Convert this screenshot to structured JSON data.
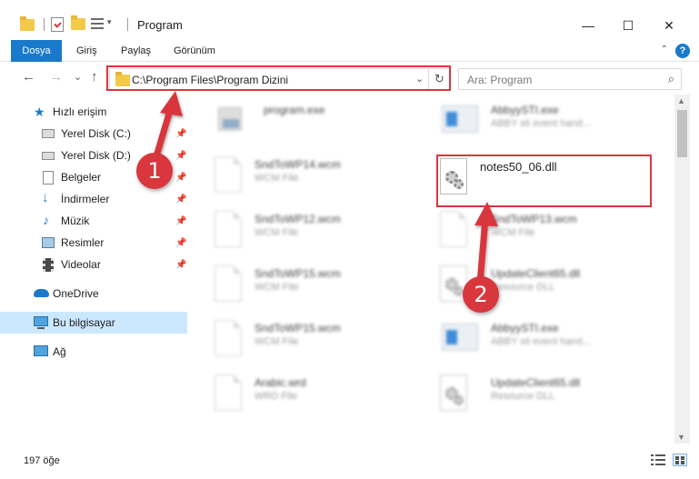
{
  "window": {
    "title": "Program",
    "minimize": "—",
    "maximize": "☐",
    "close": "✕"
  },
  "ribbon": {
    "tabs": [
      {
        "label": "Dosya"
      },
      {
        "label": "Giriş"
      },
      {
        "label": "Paylaş"
      },
      {
        "label": "Görünüm"
      }
    ],
    "help": "?",
    "collapse": "⌃"
  },
  "nav": {
    "back": "←",
    "forward": "→",
    "recent": "⌄",
    "up": "↑",
    "address": "C:\\Program Files\\Program Dizini",
    "address_dropdown": "⌄",
    "refresh": "↻",
    "search_placeholder": "Ara: Program",
    "search_icon": "⌕"
  },
  "sidebar": {
    "items": [
      {
        "label": "Hızlı erişim",
        "icon": "star-icon",
        "pinned": false
      },
      {
        "label": "Yerel Disk (C:)",
        "icon": "drive-icon",
        "pinned": true
      },
      {
        "label": "Yerel Disk (D:)",
        "icon": "drive-icon",
        "pinned": true
      },
      {
        "label": "Belgeler",
        "icon": "documents-icon",
        "pinned": true
      },
      {
        "label": "İndirmeler",
        "icon": "download-icon",
        "pinned": true
      },
      {
        "label": "Müzik",
        "icon": "music-icon",
        "pinned": true
      },
      {
        "label": "Resimler",
        "icon": "pictures-icon",
        "pinned": true
      },
      {
        "label": "Videolar",
        "icon": "videos-icon",
        "pinned": true
      },
      {
        "label": "OneDrive",
        "icon": "cloud-icon",
        "pinned": false
      },
      {
        "label": "Bu bilgisayar",
        "icon": "computer-icon",
        "pinned": false,
        "selected": true
      },
      {
        "label": "Ağ",
        "icon": "network-icon",
        "pinned": false
      }
    ],
    "pin_glyph": "📌"
  },
  "files": {
    "left": [
      {
        "name": "program.exe",
        "sub": "",
        "icon": "exe-icon"
      },
      {
        "name": "SndToWP14.wcm",
        "sub": "WCM File",
        "icon": "document-icon"
      },
      {
        "name": "SndToWP12.wcm",
        "sub": "WCM File",
        "icon": "document-icon"
      },
      {
        "name": "SndToWP15.wcm",
        "sub": "WCM File",
        "icon": "document-icon"
      },
      {
        "name": "SndToWP15.wcm",
        "sub": "WCM File",
        "icon": "document-icon"
      },
      {
        "name": "Arabic.wrd",
        "sub": "WRD File",
        "icon": "document-icon"
      }
    ],
    "right": [
      {
        "name": "AbbyySTI.exe",
        "sub": "ABBY sti event hand...",
        "icon": "app-icon"
      },
      {
        "name": "notes50_06.dll",
        "sub": "",
        "icon": "dll-icon",
        "highlighted": true
      },
      {
        "name": "SndToWP13.wcm",
        "sub": "WCM File",
        "icon": "document-icon"
      },
      {
        "name": "UpdateClient65.dll",
        "sub": "Resource DLL",
        "icon": "dll-icon"
      },
      {
        "name": "AbbyySTI.exe",
        "sub": "ABBY sti event hand...",
        "icon": "app-icon"
      },
      {
        "name": "UpdateClient65.dll",
        "sub": "Resource DLL",
        "icon": "dll-icon"
      }
    ]
  },
  "annotations": {
    "step1": "1",
    "step2": "2"
  },
  "status": {
    "count": "197 öğe"
  },
  "colors": {
    "accent": "#1979ca",
    "annotation": "#d9363e",
    "selected_bg": "#cce8ff"
  }
}
